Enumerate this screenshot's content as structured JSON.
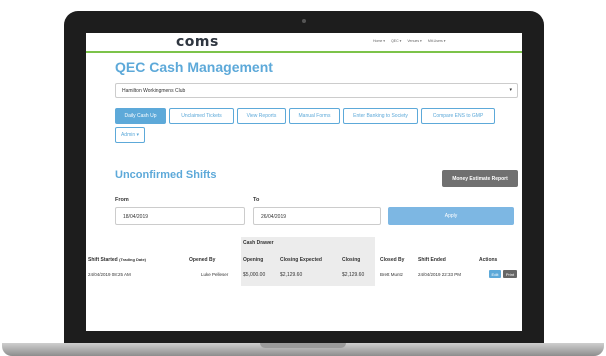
{
  "app": {
    "logo": "coms"
  },
  "topnav": [
    "Home ▾",
    "QEC ▾",
    "Venues ▾",
    "Mtt.Users ▾"
  ],
  "page_title": "QEC Cash Management",
  "club_select": {
    "value": "Hamilton Workingmens Club",
    "caret": "▾"
  },
  "tabs": [
    {
      "label": "Daily Cash Up",
      "active": true
    },
    {
      "label": "Unclaimed Tickets",
      "active": false
    },
    {
      "label": "View Reports",
      "active": false
    },
    {
      "label": "Manual Forms",
      "active": false
    },
    {
      "label": "Enter Banking to Society",
      "active": false
    },
    {
      "label": "Compare ENS to GMP",
      "active": false
    },
    {
      "label": "Admin ▾",
      "active": false
    }
  ],
  "section": {
    "title": "Unconfirmed Shifts",
    "money_button": "Money Estimate Report"
  },
  "filters": {
    "from_label": "From",
    "from_value": "18/04/2019",
    "to_label": "To",
    "to_value": "26/04/2019",
    "apply_label": "Apply"
  },
  "table": {
    "group_header": "Cash Drawer",
    "columns": {
      "shift_started": "Shift Started",
      "trading_date": "(Trading Date)",
      "opened_by": "Opened By",
      "opening": "Opening",
      "closing_expected": "Closing Expected",
      "closing": "Closing",
      "closed_by": "Closed By",
      "shift_ended": "Shift Ended",
      "actions": "Actions"
    },
    "rows": [
      {
        "shift_started": "24/04/2019 08:25 AM",
        "opened_by": "Luke Pelleser",
        "opening": "$5,000.00",
        "closing_expected": "$2,129.60",
        "closing": "$2,129.60",
        "closed_by": "Brett Muntz",
        "shift_ended": "24/04/2019 22:33 PM",
        "edit_label": "Edit",
        "print_label": "Print"
      }
    ]
  }
}
